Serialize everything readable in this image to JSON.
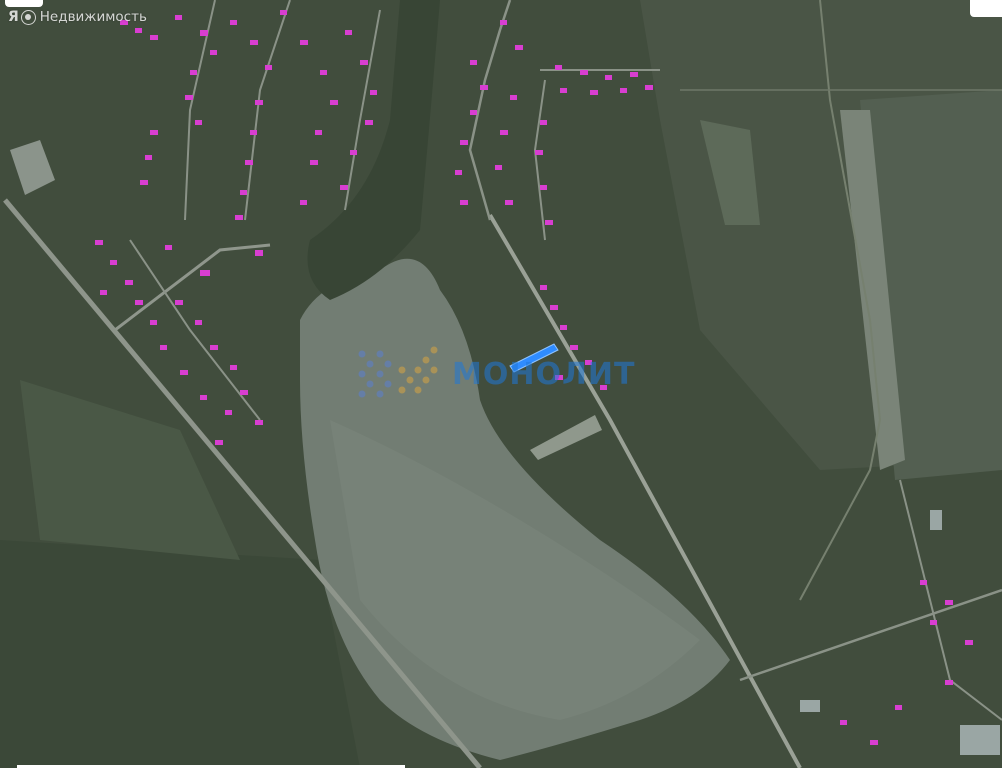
{
  "map": {
    "view_type": "satellite",
    "brand": {
      "logo_letter": "Я",
      "logo_icon": "yandex-circle-icon",
      "label": "Недвижимость"
    },
    "watermark": {
      "icon": "hexagon-dots-logo-icon",
      "text": "МОНОЛИТ"
    },
    "parcel_marker_color": "#2f8cff",
    "roof_color": "#e23ad9",
    "field_color": "#6b776b",
    "vegetation_color": "#3e4b3a"
  }
}
